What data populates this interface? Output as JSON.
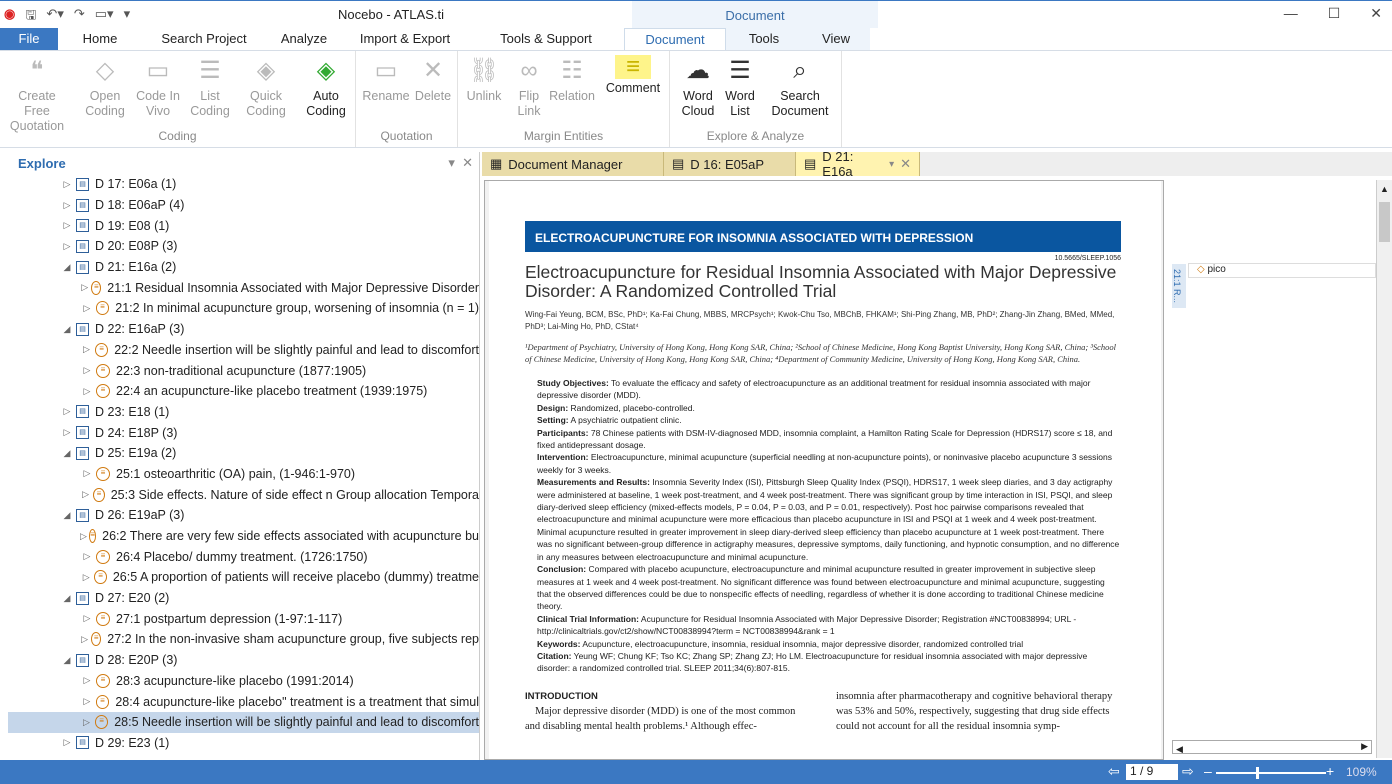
{
  "app": {
    "title": "Nocebo - ATLAS.ti",
    "context_tab_group": "Document"
  },
  "tabs": [
    "File",
    "Home",
    "Search Project",
    "Analyze",
    "Import & Export",
    "Tools & Support",
    "Document",
    "Tools",
    "View"
  ],
  "ribbon": {
    "coding": {
      "label": "Coding",
      "buttons": [
        "Create Free Quotation",
        "Open Coding",
        "Code In Vivo",
        "List Coding",
        "Quick Coding",
        "Auto Coding"
      ]
    },
    "quotation": {
      "label": "Quotation",
      "buttons": [
        "Rename",
        "Delete"
      ]
    },
    "margin": {
      "label": "Margin Entities",
      "buttons": [
        "Unlink",
        "Flip Link",
        "Relation",
        "Comment"
      ]
    },
    "explore": {
      "label": "Explore & Analyze",
      "buttons": [
        "Word Cloud",
        "Word List",
        "Search Document"
      ]
    }
  },
  "explore": {
    "title": "Explore",
    "rows": [
      {
        "t": "d",
        "l": 1,
        "text": "D 17: E06a (1)",
        "exp": false
      },
      {
        "t": "d",
        "l": 1,
        "text": "D 18: E06aP (4)",
        "exp": false
      },
      {
        "t": "d",
        "l": 1,
        "text": "D 19: E08 (1)",
        "exp": false
      },
      {
        "t": "d",
        "l": 1,
        "text": "D 20: E08P (3)",
        "exp": false
      },
      {
        "t": "d",
        "l": 1,
        "text": "D 21: E16a (2)",
        "exp": true
      },
      {
        "t": "q",
        "l": 2,
        "text": "21:1 Residual Insomnia Associated with Major Depressive   Disorder"
      },
      {
        "t": "q",
        "l": 2,
        "text": "21:2 In minimal acupuncture group, worsening of insomnia (n = 1)"
      },
      {
        "t": "d",
        "l": 1,
        "text": "D 22: E16aP (3)",
        "exp": true
      },
      {
        "t": "q",
        "l": 2,
        "text": "22:2 Needle insertion will be slightly painful and lead to discomfort"
      },
      {
        "t": "q",
        "l": 2,
        "text": "22:3 non-traditional acupuncture (1877:1905)"
      },
      {
        "t": "q",
        "l": 2,
        "text": "22:4 an acupuncture-like placebo treatment (1939:1975)"
      },
      {
        "t": "d",
        "l": 1,
        "text": "D 23: E18 (1)",
        "exp": false
      },
      {
        "t": "d",
        "l": 1,
        "text": "D 24: E18P (3)",
        "exp": false
      },
      {
        "t": "d",
        "l": 1,
        "text": "D 25: E19a (2)",
        "exp": true
      },
      {
        "t": "q",
        "l": 2,
        "text": "25:1 osteoarthritic (OA) pain, (1-946:1-970)"
      },
      {
        "t": "q",
        "l": 2,
        "text": "25:3 Side effects. Nature of side effect n Group allocation  Tempora"
      },
      {
        "t": "d",
        "l": 1,
        "text": "D 26: E19aP (3)",
        "exp": true
      },
      {
        "t": "q",
        "l": 2,
        "text": "26:2 There are very few side effects associated with acupuncture bu"
      },
      {
        "t": "q",
        "l": 2,
        "text": "26:4 Placebo/ dummy treatment. (1726:1750)"
      },
      {
        "t": "q",
        "l": 2,
        "text": "26:5 A proportion of patients will receive placebo (dummy) treatme"
      },
      {
        "t": "d",
        "l": 1,
        "text": "D 27: E20 (2)",
        "exp": true
      },
      {
        "t": "q",
        "l": 2,
        "text": "27:1 postpartum depression (1-97:1-117)"
      },
      {
        "t": "q",
        "l": 2,
        "text": "27:2 In the non-invasive sham acupuncture group, five subjects rep"
      },
      {
        "t": "d",
        "l": 1,
        "text": "D 28: E20P (3)",
        "exp": true
      },
      {
        "t": "q",
        "l": 2,
        "text": "28:3 acupuncture-like placebo (1991:2014)"
      },
      {
        "t": "q",
        "l": 2,
        "text": "28:4 acupuncture-like placebo\" treatment is a treatment that simul"
      },
      {
        "t": "q",
        "l": 2,
        "text": "28:5 Needle insertion will be slightly painful and lead to discomfort",
        "sel": true
      },
      {
        "t": "d",
        "l": 1,
        "text": "D 29: E23 (1)",
        "exp": false
      }
    ]
  },
  "doc_tabs": [
    "Document Manager",
    "D 16: E05aP",
    "D 21: E16a"
  ],
  "document": {
    "banner": "ELECTROACUPUNCTURE FOR INSOMNIA ASSOCIATED WITH DEPRESSION",
    "doi": "10.5665/SLEEP.1056",
    "title": "Electroacupuncture for Residual Insomnia Associated with Major Depressive Disorder: A Randomized Controlled Trial",
    "authors": "Wing-Fai Yeung, BCM, BSc, PhD¹; Ka-Fai Chung, MBBS, MRCPsych¹; Kwok-Chu Tso, MBChB, FHKAM¹; Shi-Ping Zhang, MB, PhD²; Zhang-Jin Zhang, BMed, MMed, PhD³; Lai-Ming Ho, PhD, CStat⁴",
    "affiliations": "¹Department of Psychiatry, University of Hong Kong, Hong Kong SAR, China; ²School of Chinese Medicine, Hong Kong Baptist University, Hong Kong SAR, China; ³School of Chinese Medicine, University of Hong Kong, Hong Kong SAR, China; ⁴Department of Community Medicine, University of Hong Kong, Hong Kong SAR, China.",
    "abstract": [
      {
        "h": "Study Objectives:",
        "t": " To evaluate the efficacy and safety of electroacupuncture as an additional treatment for residual insomnia associated with major depressive disorder (MDD)."
      },
      {
        "h": "Design:",
        "t": " Randomized, placebo-controlled."
      },
      {
        "h": "Setting:",
        "t": " A psychiatric outpatient clinic."
      },
      {
        "h": "Participants:",
        "t": " 78 Chinese patients with DSM-IV-diagnosed MDD, insomnia complaint, a Hamilton Rating Scale for Depression (HDRS17) score ≤ 18, and fixed antidepressant dosage."
      },
      {
        "h": "Intervention:",
        "t": " Electroacupuncture, minimal acupuncture (superficial needling at non-acupuncture points), or noninvasive placebo acupuncture 3 sessions weekly for 3 weeks."
      },
      {
        "h": "Measurements and Results:",
        "t": " Insomnia Severity Index (ISI), Pittsburgh Sleep Quality Index (PSQI), HDRS17, 1 week sleep diaries, and 3 day actigraphy were administered at baseline, 1 week post-treatment, and 4 week post-treatment. There was significant group by time interaction in ISI, PSQI, and sleep diary-derived sleep efficiency (mixed-effects models, P = 0.04, P = 0.03, and P = 0.01, respectively). Post hoc pairwise comparisons revealed that electroacupuncture and minimal acupuncture were more efficacious than placebo acupuncture in ISI and PSQI at 1 week and 4 week post-treatment. Minimal acupuncture resulted in greater improvement in sleep diary-derived sleep efficiency than placebo acupuncture at 1 week post-treatment. There was no significant between-group difference in actigraphy measures, depressive symptoms, daily functioning, and hypnotic consumption, and no difference in any measures between electroacupuncture and minimal acupuncture."
      },
      {
        "h": "Conclusion:",
        "t": " Compared with placebo acupuncture, electroacupuncture and minimal acupuncture resulted in greater improvement in subjective sleep measures at 1 week and 4 week post-treatment. No significant difference was found between electroacupuncture and minimal acupuncture, suggesting that the observed differences could be due to nonspecific effects of needling, regardless of whether it is done according to traditional Chinese medicine theory."
      },
      {
        "h": "Clinical Trial Information:",
        "t": " Acupuncture for Residual Insomnia Associated with Major Depressive Disorder; Registration #NCT00838994; URL - http://clinicaltrials.gov/ct2/show/NCT00838994?term = NCT00838994&rank = 1"
      },
      {
        "h": "Keywords:",
        "t": " Acupuncture, electroacupuncture, insomnia, residual insomnia, major depressive disorder, randomized controlled trial"
      },
      {
        "h": "Citation:",
        "t": " Yeung WF; Chung KF; Tso KC; Zhang SP; Zhang ZJ; Ho LM. Electroacupuncture for residual insomnia associated with major depressive disorder: a randomized controlled trial. SLEEP 2011;34(6):807-815."
      }
    ],
    "intro_heading": "INTRODUCTION",
    "col1": "Major depressive disorder (MDD) is one of the most common and disabling mental health problems.¹ Although effec-",
    "col2": "insomnia after pharmacotherapy and cognitive behavioral therapy was 53% and 50%, respectively, suggesting that drug side effects could not account for all the residual insomnia symp-"
  },
  "margin": {
    "quote_label": "21:1 R...",
    "code": "pico"
  },
  "status": {
    "page": "1 / 9",
    "zoom": "109%"
  }
}
